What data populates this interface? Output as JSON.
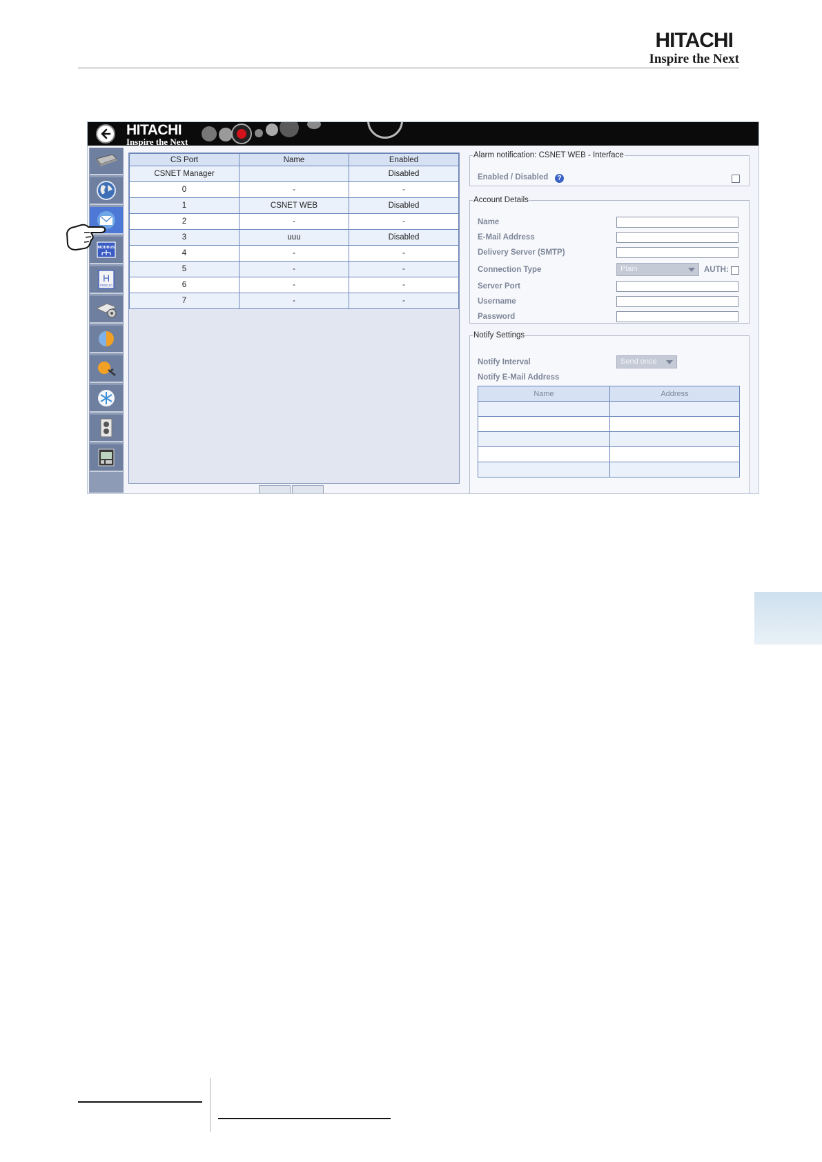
{
  "brand": {
    "name": "HITACHI",
    "tagline": "Inspire the Next"
  },
  "app": {
    "header": {
      "logo_name": "HITACHI",
      "logo_tagline": "Inspire the Next",
      "back_icon": "back-arrow-icon"
    },
    "sidebar": {
      "items": [
        {
          "icon": "device-icon",
          "active": false
        },
        {
          "icon": "globe-icon",
          "active": false
        },
        {
          "icon": "email-icon",
          "active": true
        },
        {
          "icon": "modbus-icon",
          "label": "MODBUS",
          "active": false
        },
        {
          "icon": "fidelio-icon",
          "label": "FIDELIO",
          "letter": "H",
          "active": false
        },
        {
          "icon": "indoor-unit-settings-icon",
          "active": false
        },
        {
          "icon": "heat-cool-icon",
          "active": false
        },
        {
          "icon": "sun-maintenance-icon",
          "active": false
        },
        {
          "icon": "snowflake-icon",
          "active": false
        },
        {
          "icon": "outdoor-unit-icon",
          "active": false
        },
        {
          "icon": "controller-icon",
          "active": false
        }
      ]
    },
    "ports_table": {
      "columns": [
        "CS Port",
        "Name",
        "Enabled"
      ],
      "rows": [
        {
          "port": "CSNET Manager",
          "name": "",
          "enabled": "Disabled"
        },
        {
          "port": "0",
          "name": "-",
          "enabled": "-"
        },
        {
          "port": "1",
          "name": "CSNET WEB",
          "enabled": "Disabled"
        },
        {
          "port": "2",
          "name": "-",
          "enabled": "-"
        },
        {
          "port": "3",
          "name": "uuu",
          "enabled": "Disabled"
        },
        {
          "port": "4",
          "name": "-",
          "enabled": "-"
        },
        {
          "port": "5",
          "name": "-",
          "enabled": "-"
        },
        {
          "port": "6",
          "name": "-",
          "enabled": "-"
        },
        {
          "port": "7",
          "name": "-",
          "enabled": "-"
        }
      ]
    },
    "alarm": {
      "legend": "Alarm notification: CSNET WEB - Interface",
      "enabled_label": "Enabled / Disabled",
      "help_icon": "help-icon",
      "help_glyph": "?"
    },
    "account": {
      "legend": "Account Details",
      "name_label": "Name",
      "email_label": "E-Mail Address",
      "smtp_label": "Delivery Server (SMTP)",
      "conn_type_label": "Connection Type",
      "conn_type_value": "Plain",
      "auth_label": "AUTH:",
      "server_port_label": "Server Port",
      "username_label": "Username",
      "password_label": "Password"
    },
    "notify": {
      "legend": "Notify Settings",
      "interval_label": "Notify Interval",
      "interval_value": "Send once",
      "email_list_label": "Notify E-Mail Address",
      "columns": [
        "Name",
        "Address"
      ],
      "rows": [
        [
          "",
          ""
        ],
        [
          "",
          ""
        ],
        [
          "",
          ""
        ],
        [
          "",
          ""
        ],
        [
          "",
          ""
        ]
      ]
    }
  },
  "colors": {
    "topbar": "#0b0b0b",
    "sidebar": "#8e9bb6",
    "active": "#4d78d6",
    "table_header": "#d6e1f3",
    "grid_line": "#6a86ba"
  }
}
